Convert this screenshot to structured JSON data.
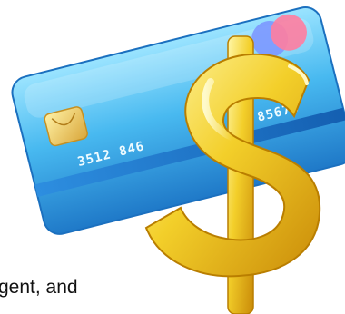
{
  "card": {
    "number_left": "3512 846",
    "number_right": "85678"
  },
  "caption": {
    "text": "gent, and"
  },
  "colors": {
    "card_light": "#8fdcff",
    "card_mid": "#3fb0ec",
    "card_dark": "#1f79c8",
    "stripe": "#1a6bc0",
    "chip": "#f3d36b",
    "dollar_light": "#fff7a8",
    "dollar_mid": "#f3cf2a",
    "dollar_dark": "#c98a08",
    "logo_blue": "#7c98ff",
    "logo_pink": "#ff7da0"
  },
  "icons": {
    "card": "credit-card-icon",
    "dollar": "dollar-sign-icon"
  }
}
